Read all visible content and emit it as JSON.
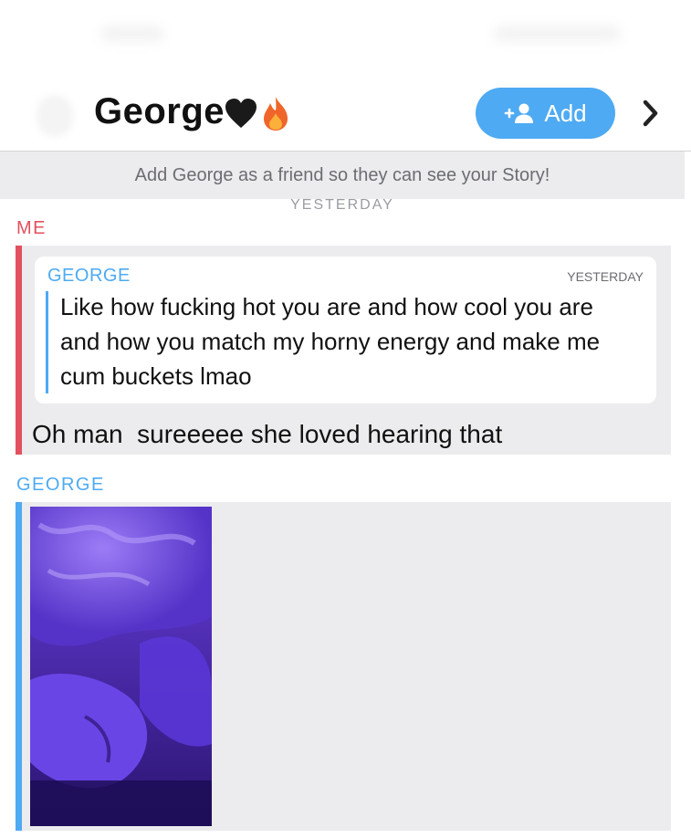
{
  "header": {
    "name": "George",
    "emojis": [
      "black-heart",
      "fire"
    ],
    "add_label": "Add",
    "add_icon": "add-friend-icon"
  },
  "banner": {
    "text": "Add George as a friend so they can see your Story!"
  },
  "date_separator": "YESTERDAY",
  "colors": {
    "me": "#e1515f",
    "friend": "#4eaaf2",
    "message_bg": "#ececee",
    "add_button": "#4eaaf2"
  },
  "messages": [
    {
      "sender": "ME",
      "quote": {
        "sender": "GEORGE",
        "time": "YESTERDAY",
        "text": "Like how fucking hot you are and how cool you are and how you match my horny energy and make me cum buckets lmao"
      },
      "text": "Oh man  sureeeee she loved hearing that"
    },
    {
      "sender": "GEORGE",
      "media": "photo"
    }
  ]
}
